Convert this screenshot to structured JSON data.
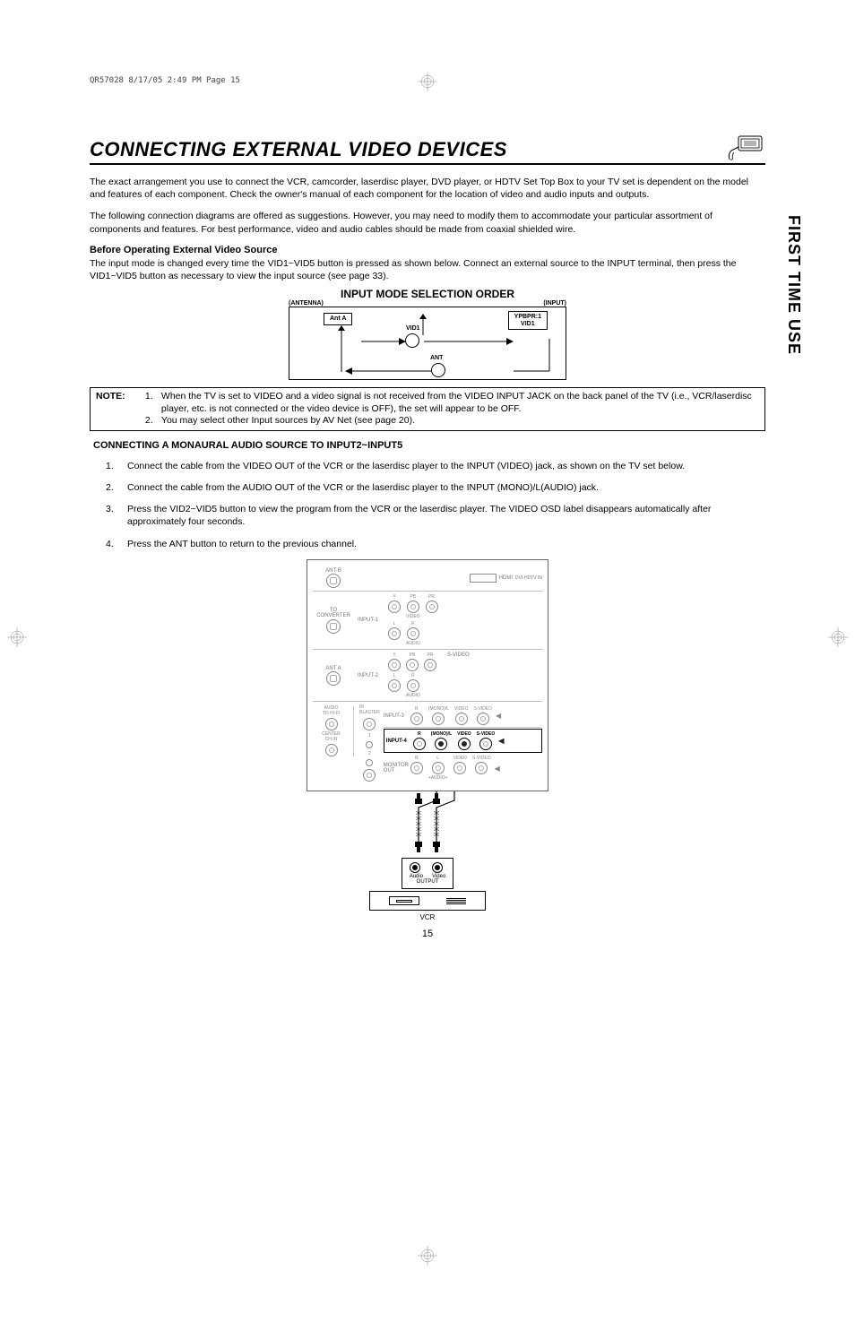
{
  "spec_line": "QR57028  8/17/05  2:49 PM  Page 15",
  "title": "CONNECTING EXTERNAL VIDEO DEVICES",
  "side_tab": "FIRST TIME USE",
  "intro_p1": "The exact arrangement you use to connect the VCR, camcorder, laserdisc player, DVD player, or HDTV Set Top Box to your TV set is dependent on the model and features of each component.  Check the owner's manual of each component for the location of video and audio inputs and outputs.",
  "intro_p2": "The following connection diagrams are offered as suggestions.  However, you may need to modify them to accommodate your particular assortment of components and features.  For best performance, video and audio cables should be made from coaxial shielded wire.",
  "before_head": "Before Operating External Video Source",
  "before_text": "The input mode is changed every time the VID1~VID5 button is pressed as shown below.  Connect an external source to the INPUT terminal, then press the VID1~VID5 button as necessary to view the input source (see page 33).",
  "diagram": {
    "title": "INPUT MODE SELECTION ORDER",
    "left_label": "(ANTENNA)",
    "right_label": "(INPUT)",
    "ant_a": "Ant A",
    "ypbpr": "YPBPR:1",
    "vid1_top": "VID1",
    "vid1_mid": "VID1",
    "ant": "ANT"
  },
  "note": {
    "label": "NOTE:",
    "item1": "When the TV is set to VIDEO and a video signal is not received from the VIDEO INPUT JACK on the back panel of the TV (i.e., VCR/laserdisc player, etc. is not connected or the video device is OFF), the set will appear to be OFF.",
    "item2": "You may select other Input sources by AV Net (see page 20)."
  },
  "section_head": "CONNECTING A MONAURAL AUDIO SOURCE TO INPUT2~INPUT5",
  "steps": {
    "s1": "Connect the cable from the VIDEO OUT of the VCR or the laserdisc player to the INPUT (VIDEO) jack, as shown on the TV set below.",
    "s2": "Connect the cable from the AUDIO OUT of the VCR or the laserdisc player to the INPUT (MONO)/L(AUDIO) jack.",
    "s3": "Press the VID2~VID5 button to view the program from the VCR or the laserdisc player.  The VIDEO OSD label disappears automatically after approximately four seconds.",
    "s4": "Press the ANT button to return to the previous channel."
  },
  "rear": {
    "ant_b": "ANT-B",
    "to_conv": "TO\nCONVERTER",
    "ant_a": "ANT A",
    "audio_hifi": "AUDIO\nTO HI-FI",
    "center_ch": "CENTER\nCH IN",
    "ir_blaster": "IR\nBLASTER",
    "input1": "INPUT-1",
    "input2": "INPUT-2",
    "input3": "INPUT-3",
    "input4": "INPUT-4",
    "monitor_out": "MONITOR\nOUT",
    "dvi_hdtv": "DVI-HDTV IN",
    "hdmi": "HDMI",
    "y": "Y",
    "pb": "PB",
    "pr": "PR",
    "l": "L",
    "r": "R",
    "mono_l": "(MONO)/L",
    "video": "VIDEO",
    "audio": "AUDIO",
    "s_video": "S-VIDEO"
  },
  "vcr": {
    "audio": "Audio",
    "video": "Video",
    "output": "OUTPUT",
    "caption": "VCR"
  },
  "page_num": "15"
}
